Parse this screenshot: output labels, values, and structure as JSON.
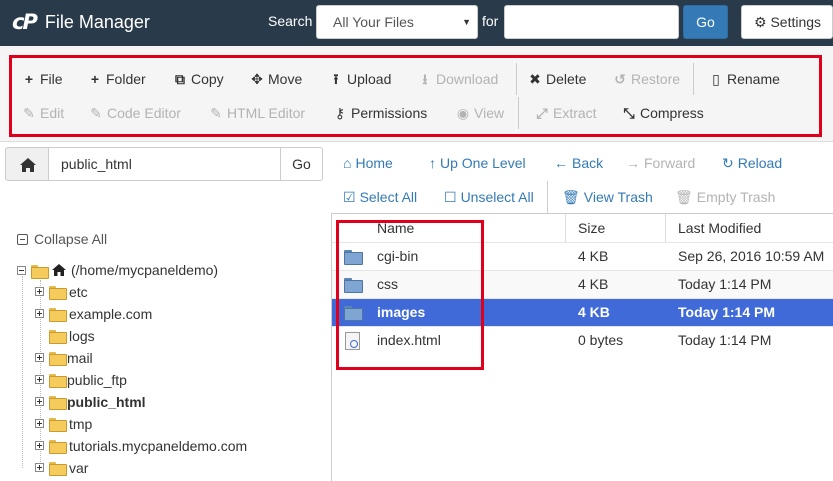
{
  "header": {
    "logo": "cP",
    "title": "File Manager",
    "search_label": "Search",
    "scope_value": "All Your Files",
    "for_label": "for",
    "search_value": "",
    "go_label": "Go",
    "settings_label": "Settings"
  },
  "toolbar": {
    "file": "File",
    "folder": "Folder",
    "copy": "Copy",
    "move": "Move",
    "upload": "Upload",
    "download": "Download",
    "delete": "Delete",
    "restore": "Restore",
    "rename": "Rename",
    "edit": "Edit",
    "code_editor": "Code Editor",
    "html_editor": "HTML Editor",
    "permissions": "Permissions",
    "view": "View",
    "extract": "Extract",
    "compress": "Compress"
  },
  "path_bar": {
    "value": "public_html",
    "go_label": "Go"
  },
  "nav": {
    "home": "Home",
    "up_one_level": "Up One Level",
    "back": "Back",
    "forward": "Forward",
    "reload": "Reload",
    "select_all": "Select All",
    "unselect_all": "Unselect All",
    "view_trash": "View Trash",
    "empty_trash": "Empty Trash"
  },
  "tree": {
    "collapse_all": "Collapse All",
    "root": "(/home/mycpaneldemo)",
    "items": [
      {
        "label": "etc"
      },
      {
        "label": "example.com"
      },
      {
        "label": "logs"
      },
      {
        "label": "mail"
      },
      {
        "label": "public_ftp"
      },
      {
        "label": "public_html"
      },
      {
        "label": "tmp"
      },
      {
        "label": "tutorials.mycpaneldemo.com"
      },
      {
        "label": "var"
      }
    ]
  },
  "table": {
    "columns": {
      "name": "Name",
      "size": "Size",
      "modified": "Last Modified"
    },
    "rows": [
      {
        "name": "cgi-bin",
        "size": "4 KB",
        "modified": "Sep 26, 2016 10:59 AM",
        "type": "folder"
      },
      {
        "name": "css",
        "size": "4 KB",
        "modified": "Today 1:14 PM",
        "type": "folder"
      },
      {
        "name": "images",
        "size": "4 KB",
        "modified": "Today 1:14 PM",
        "type": "folder"
      },
      {
        "name": "index.html",
        "size": "0 bytes",
        "modified": "Today 1:14 PM",
        "type": "file"
      }
    ]
  },
  "colors": {
    "header_bg": "#293a4a",
    "primary": "#337ab7",
    "selected_row": "#3f6ad8",
    "highlight_box": "#e0001b"
  }
}
